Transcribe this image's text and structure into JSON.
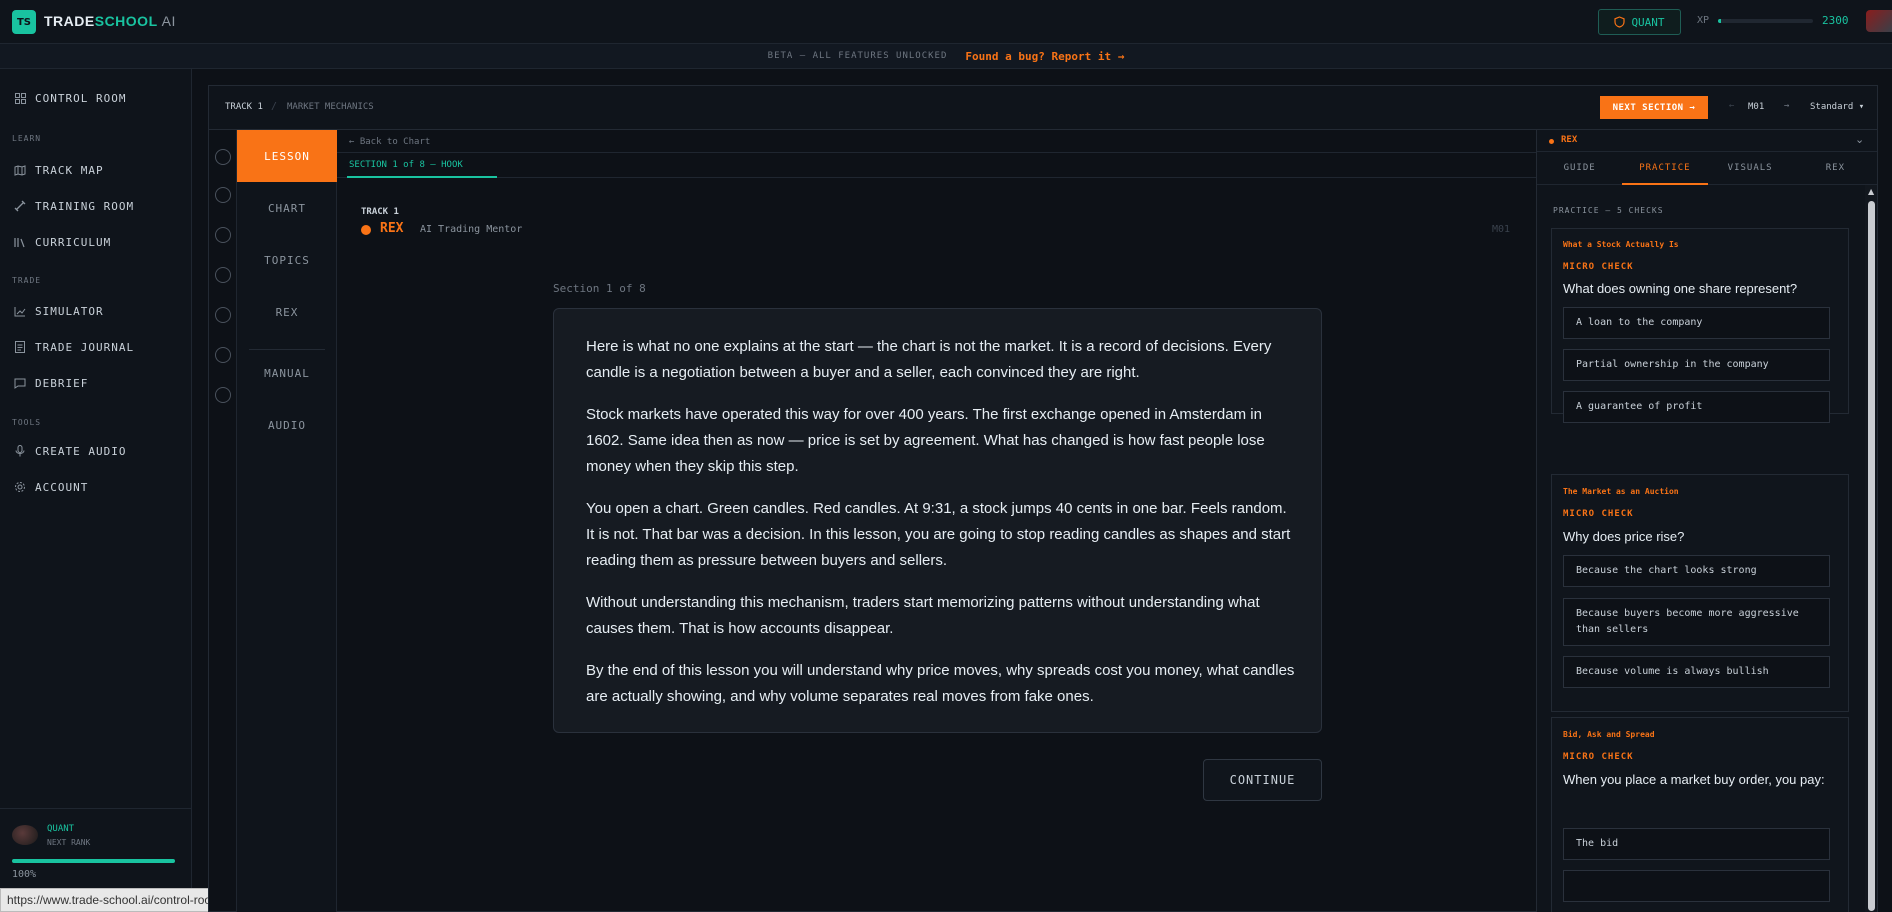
{
  "app": {
    "logo_badge": "TS",
    "brand_a": "TRADE",
    "brand_b": "SCHOOL",
    "brand_c": "AI",
    "rank": "QUANT",
    "xp_label": "XP",
    "xp_value": "2300",
    "xp_fraction": 0.03
  },
  "beta": {
    "text": "BETA — ALL FEATURES UNLOCKED",
    "bug": "Found a bug? Report it →"
  },
  "sidebar": {
    "items": [
      {
        "label": "CONTROL ROOM",
        "icon": "grid-icon"
      },
      {
        "label": "TRACK MAP",
        "icon": "map-icon"
      },
      {
        "label": "TRAINING ROOM",
        "icon": "dumbbell-icon"
      },
      {
        "label": "CURRICULUM",
        "icon": "books-icon"
      },
      {
        "label": "SIMULATOR",
        "icon": "chart-line-icon"
      },
      {
        "label": "TRADE JOURNAL",
        "icon": "journal-icon"
      },
      {
        "label": "DEBRIEF",
        "icon": "chat-icon"
      },
      {
        "label": "CREATE AUDIO",
        "icon": "mic-icon"
      },
      {
        "label": "ACCOUNT",
        "icon": "gear-icon"
      }
    ],
    "sections": [
      "LEARN",
      "TRADE",
      "TOOLS"
    ],
    "footer": {
      "rank": "QUANT",
      "next": "NEXT RANK",
      "progress_pct": "100%",
      "progress_fraction": 1.0
    },
    "status_url": "https://www.trade-school.ai/control-room"
  },
  "header": {
    "track": "TRACK 1",
    "sep": "/",
    "module": "MARKET MECHANICS",
    "next_section": "NEXT SECTION →",
    "prev_arrow": "←",
    "module_code": "M01",
    "next_arrow": "→",
    "mode": "Standard ▾"
  },
  "tabs": [
    "LESSON",
    "CHART",
    "TOPICS",
    "REX",
    "MANUAL",
    "AUDIO"
  ],
  "lesson": {
    "back": "← Back to Chart",
    "section_tab": "SECTION 1 of 8 — HOOK",
    "track": "TRACK 1",
    "mentor_name": "REX",
    "mentor_role": "AI Trading Mentor",
    "module_code": "M01",
    "section_progress": "Section 1 of 8",
    "paragraphs": [
      "Here is what no one explains at the start — the chart is not the market. It is a record of decisions. Every candle is a negotiation between a buyer and a seller, each convinced they are right.",
      "Stock markets have operated this way for over 400 years. The first exchange opened in Amsterdam in 1602. Same idea then as now — price is set by agreement. What has changed is how fast people lose money when they skip this step.",
      "You open a chart. Green candles. Red candles. At 9:31, a stock jumps 40 cents in one bar. Feels random. It is not. That bar was a decision. In this lesson, you are going to stop reading candles as shapes and start reading them as pressure between buyers and sellers.",
      "Without understanding this mechanism, traders start memorizing patterns without understanding what causes them. That is how accounts disappear.",
      "By the end of this lesson you will understand why price moves, why spreads cost you money, what candles are actually showing, and why volume separates real moves from fake ones."
    ],
    "continue": "CONTINUE"
  },
  "rex_panel": {
    "title": "REX",
    "chevron": "⌄",
    "tabs": [
      "GUIDE",
      "PRACTICE",
      "VISUALS",
      "REX"
    ],
    "practice_label": "PRACTICE — 5 CHECKS",
    "checks": [
      {
        "topic": "What a Stock Actually Is",
        "kind": "MICRO CHECK",
        "question": "What does owning one share represent?",
        "options": [
          "A loan to the company",
          "Partial ownership in the company",
          "A guarantee of profit"
        ]
      },
      {
        "topic": "The Market as an Auction",
        "kind": "MICRO CHECK",
        "question": "Why does price rise?",
        "options": [
          "Because the chart looks strong",
          "Because buyers become more aggressive than sellers",
          "Because volume is always bullish"
        ]
      },
      {
        "topic": "Bid, Ask and Spread",
        "kind": "MICRO CHECK",
        "question": "When you place a market buy order, you pay:",
        "options": [
          "The bid"
        ]
      }
    ]
  },
  "colors": {
    "accent": "#f97316",
    "brand": "#19c3a0",
    "bg": "#0d1117"
  }
}
